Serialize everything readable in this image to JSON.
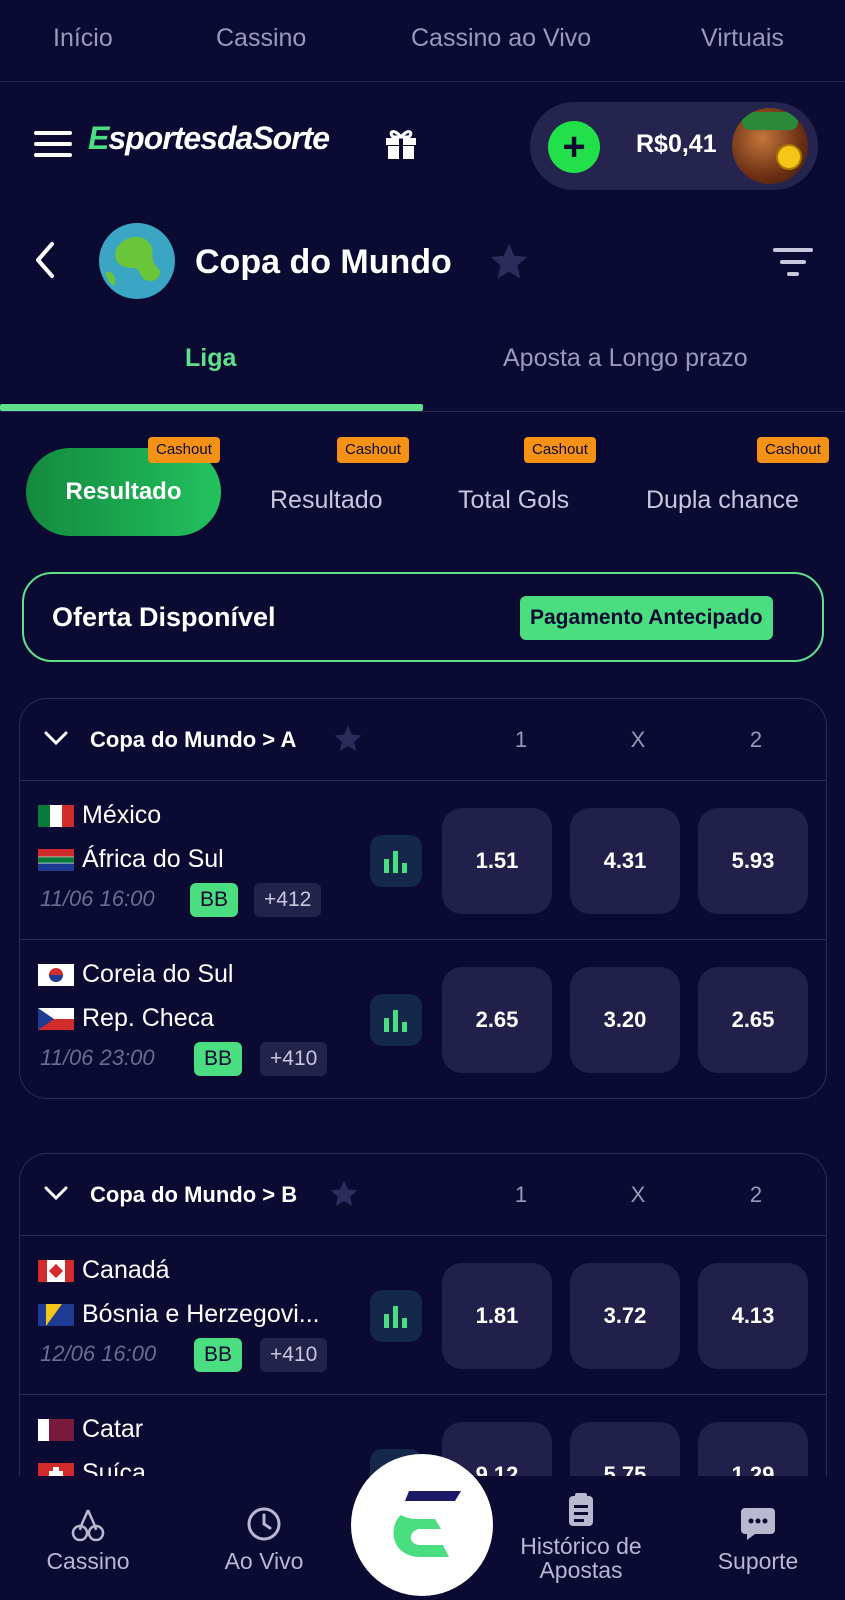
{
  "topnav": {
    "items": [
      "Início",
      "Cassino",
      "Cassino ao Vivo",
      "Virtuais"
    ]
  },
  "header": {
    "logo_text_accent": "E",
    "logo_text": "sportesdaSorte",
    "balance": "R$0,41"
  },
  "page": {
    "title": "Copa do Mundo"
  },
  "tabs": {
    "liga": "Liga",
    "long_term": "Aposta a Longo prazo"
  },
  "markets": {
    "cashout_label": "Cashout",
    "items": [
      "Resultado",
      "Resultado",
      "Total Gols",
      "Dupla chance"
    ]
  },
  "offer": {
    "title": "Oferta Disponível",
    "badge": "Pagamento Antecipado"
  },
  "columns": [
    "1",
    "X",
    "2"
  ],
  "leagues": [
    {
      "name": "Copa do Mundo > A",
      "matches": [
        {
          "home": "México",
          "away": "África do Sul",
          "date": "11/06 16:00",
          "bb": "BB",
          "more": "+412",
          "odds": [
            "1.51",
            "4.31",
            "5.93"
          ]
        },
        {
          "home": "Coreia do Sul",
          "away": "Rep. Checa",
          "date": "11/06 23:00",
          "bb": "BB",
          "more": "+410",
          "odds": [
            "2.65",
            "3.20",
            "2.65"
          ]
        }
      ]
    },
    {
      "name": "Copa do Mundo > B",
      "matches": [
        {
          "home": "Canadá",
          "away": "Bósnia e Herzegovi...",
          "date": "12/06 16:00",
          "bb": "BB",
          "more": "+410",
          "odds": [
            "1.81",
            "3.72",
            "4.13"
          ]
        },
        {
          "home": "Catar",
          "away": "Suíça",
          "date": "",
          "bb": "",
          "more": "",
          "odds": [
            "9.12",
            "5.75",
            "1.29"
          ]
        }
      ]
    }
  ],
  "bottomnav": {
    "cassino": "Cassino",
    "ao_vivo": "Ao Vivo",
    "historico": "Histórico de Apostas",
    "suporte": "Suporte"
  },
  "colors": {
    "background": "#0a0a33",
    "accent_green": "#4ade80",
    "cashout_orange": "#f59216",
    "odd_bg": "#20204a"
  }
}
